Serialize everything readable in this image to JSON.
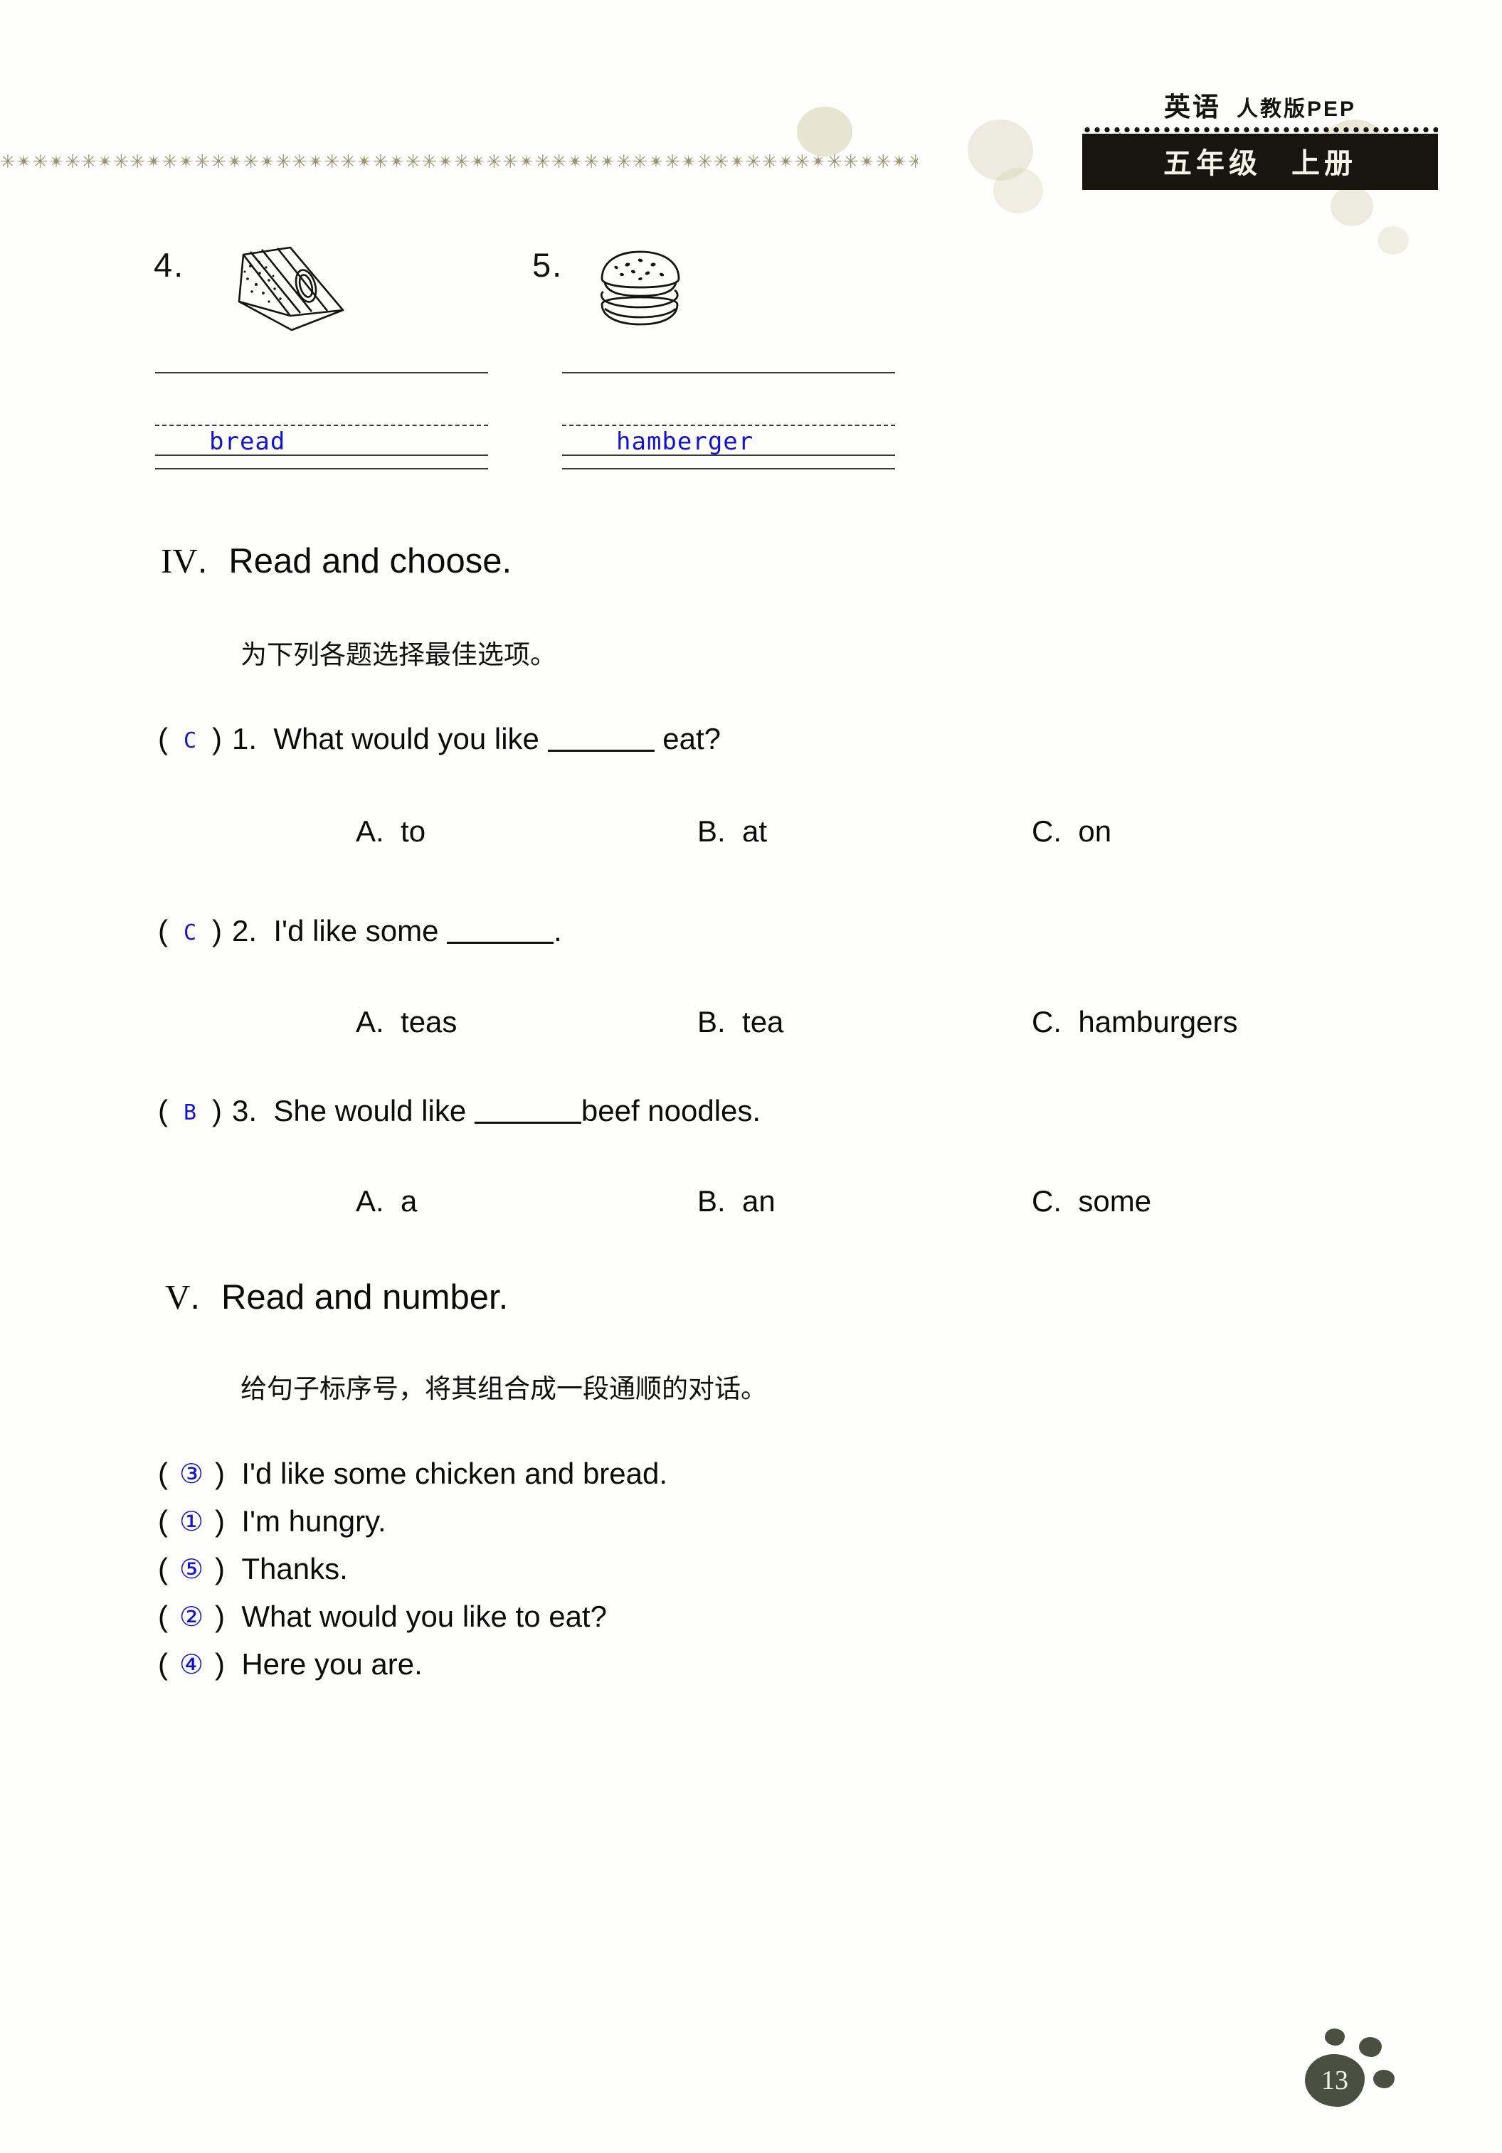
{
  "header": {
    "subject": "英语",
    "edition": "人教版PEP",
    "grade": "五年级",
    "volume": "上册"
  },
  "picture_words": {
    "items": [
      {
        "number": "4.",
        "icon": "sandwich-icon",
        "answer": "bread"
      },
      {
        "number": "5.",
        "icon": "hamburger-icon",
        "answer": "hamberger"
      }
    ]
  },
  "section_iv": {
    "roman": "IV",
    "dot": ".",
    "title": "Read and choose.",
    "instruction": "为下列各题选择最佳选项。",
    "questions": [
      {
        "answer": "C",
        "number": "1.",
        "text_before": "What would you like",
        "text_after": "eat?",
        "options": [
          {
            "label": "A.",
            "text": "to"
          },
          {
            "label": "B.",
            "text": "at"
          },
          {
            "label": "C.",
            "text": "on"
          }
        ]
      },
      {
        "answer": "C",
        "number": "2.",
        "text_before": "I'd like some",
        "text_after": ".",
        "options": [
          {
            "label": "A.",
            "text": "teas"
          },
          {
            "label": "B.",
            "text": "tea"
          },
          {
            "label": "C.",
            "text": "hamburgers"
          }
        ]
      },
      {
        "answer": "B",
        "number": "3.",
        "text_before": "She would like",
        "text_after": "beef noodles.",
        "options": [
          {
            "label": "A.",
            "text": "a"
          },
          {
            "label": "B.",
            "text": "an"
          },
          {
            "label": "C.",
            "text": "some"
          }
        ]
      }
    ]
  },
  "section_v": {
    "roman": "V",
    "dot": ".",
    "title": "Read and number.",
    "instruction": "给句子标序号，将其组合成一段通顺的对话。",
    "sentences": [
      {
        "order": "③",
        "text": "I'd like some chicken and bread."
      },
      {
        "order": "①",
        "text": "I'm hungry."
      },
      {
        "order": "⑤",
        "text": "Thanks."
      },
      {
        "order": "②",
        "text": "What would you like to eat?"
      },
      {
        "order": "④",
        "text": "Here you are."
      }
    ]
  },
  "footer": {
    "page_number": "13"
  },
  "colors": {
    "ink_blue": "#1313d8",
    "print_black": "#0b0b0b",
    "border_olive": "#9a9478"
  }
}
